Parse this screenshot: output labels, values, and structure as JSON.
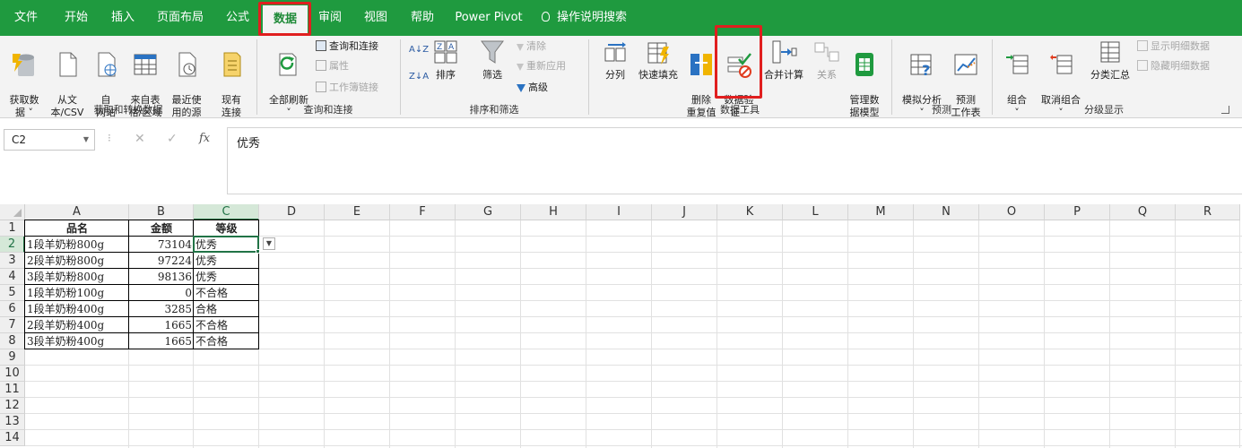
{
  "tabs": [
    "文件",
    "开始",
    "插入",
    "页面布局",
    "公式",
    "数据",
    "审阅",
    "视图",
    "帮助",
    "Power Pivot"
  ],
  "tell_me": "操作说明搜索",
  "ribbon": {
    "get_data": "获取数\n据 ˅",
    "from_text": "从文\n本/CSV",
    "from_web": "自\n网站",
    "from_table": "来自表\n格/区域",
    "recent_sources": "最近使\n用的源",
    "existing_conn": "现有\n连接",
    "group_get": "获取和转换数据",
    "refresh_all": "全部刷新\n˅",
    "queries_conn": "查询和连接",
    "properties": "属性",
    "edit_links": "工作簿链接",
    "group_queries": "查询和连接",
    "sort_az": "A↓Z",
    "sort": "排序",
    "sort_za": "Z↓A",
    "filter": "筛选",
    "clear": "清除",
    "reapply": "重新应用",
    "advanced": "高级",
    "group_sort": "排序和筛选",
    "text_to_cols": "分列",
    "flash_fill": "快速填充",
    "remove_dup": "删除\n重复值",
    "data_validation": "数据验\n证 ˅",
    "consolidate": "合并计算",
    "relationships": "关系",
    "manage_model": "管理数\n据模型",
    "group_tools": "数据工具",
    "what_if": "模拟分析\n˅",
    "forecast": "预测\n工作表",
    "group_forecast": "预测",
    "group": "组合\n˅",
    "ungroup": "取消组合\n˅",
    "subtotal": "分类汇总",
    "show_detail": "显示明细数据",
    "hide_detail": "隐藏明细数据",
    "group_outline": "分级显示"
  },
  "formula_bar": {
    "name_box": "C2",
    "cancel": "✕",
    "enter": "✓",
    "fx": "fx",
    "content": "优秀"
  },
  "columns": [
    "A",
    "B",
    "C",
    "D",
    "E",
    "F",
    "G",
    "H",
    "I",
    "J",
    "K",
    "L",
    "M",
    "N",
    "O",
    "P",
    "Q",
    "R"
  ],
  "rows": [
    "1",
    "2",
    "3",
    "4",
    "5",
    "6",
    "7",
    "8",
    "9",
    "10",
    "11",
    "12",
    "13",
    "14"
  ],
  "table": {
    "headers": [
      "品名",
      "金额",
      "等级"
    ],
    "rows": [
      [
        "1段羊奶粉800g",
        "73104",
        "优秀"
      ],
      [
        "2段羊奶粉800g",
        "97224",
        "优秀"
      ],
      [
        "3段羊奶粉800g",
        "98136",
        "优秀"
      ],
      [
        "1段羊奶粉100g",
        "0",
        "不合格"
      ],
      [
        "1段羊奶粉400g",
        "3285",
        "合格"
      ],
      [
        "2段羊奶粉400g",
        "1665",
        "不合格"
      ],
      [
        "3段羊奶粉400g",
        "1665",
        "不合格"
      ]
    ]
  },
  "colors": {
    "ribbon_green": "#1f9a3f",
    "highlight_red": "#e01f1f",
    "selection_green": "#217346"
  },
  "icons": [
    "get-data-icon",
    "text-file-icon",
    "web-icon",
    "table-icon",
    "recent-icon",
    "connections-icon",
    "refresh-icon",
    "sort-icon",
    "filter-icon",
    "text-to-columns-icon",
    "flash-fill-icon",
    "remove-duplicates-icon",
    "data-validation-icon",
    "consolidate-icon",
    "relationships-icon",
    "data-model-icon",
    "what-if-icon",
    "forecast-icon",
    "group-icon",
    "ungroup-icon",
    "subtotal-icon",
    "lightbulb-icon",
    "dropdown-arrow-icon"
  ]
}
